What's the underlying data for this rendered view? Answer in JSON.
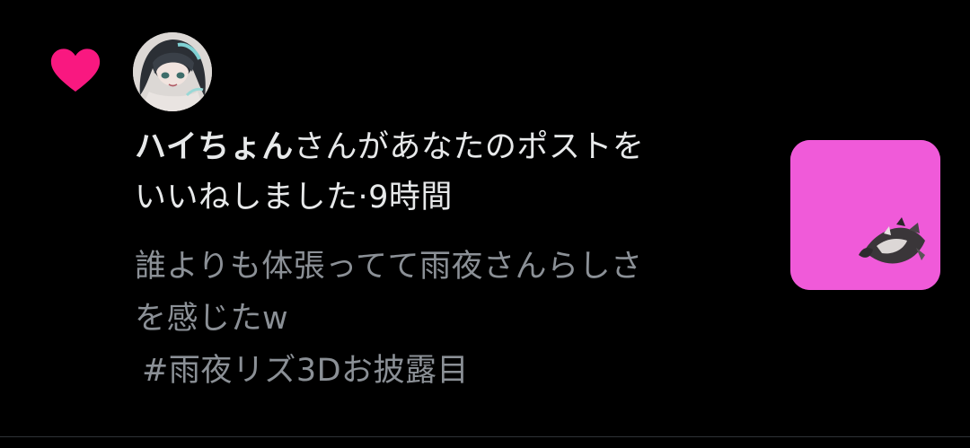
{
  "colors": {
    "background": "#000000",
    "heart": "#f91880",
    "primary_text": "#e7e9ea",
    "secondary_text": "#8b9096",
    "thumbnail_bg": "#f05ad9",
    "divider": "#2f3336"
  },
  "notification": {
    "icon": "heart-icon",
    "user_name": "ハイちょん",
    "action_line1": "さんがあなたのポストを",
    "action_line2": "いいねしました",
    "separator": "·",
    "time": "9時間",
    "post_lines": [
      "誰よりも体張ってて雨夜さんらしさ",
      "を感じたw",
      "#雨夜リズ3Dお披露目"
    ]
  }
}
